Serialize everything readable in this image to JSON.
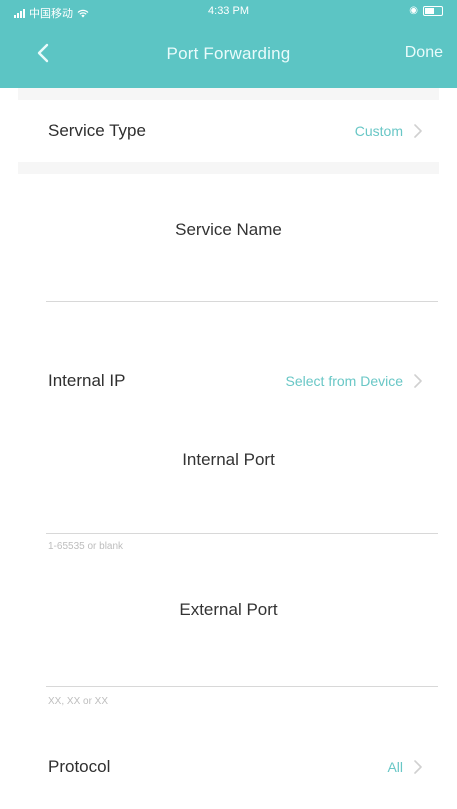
{
  "status_bar": {
    "carrier": "中国移动",
    "time": "4:33 PM",
    "battery_icon": "battery-icon",
    "wifi_icon": "wifi-icon"
  },
  "nav": {
    "title": "Port Forwarding",
    "done_label": "Done",
    "back_icon": "chevron-left-icon",
    "bg_color": "#5cc5c4",
    "text_color": "#e9fbfb"
  },
  "form": {
    "service_type": {
      "label": "Service Type",
      "value": "Custom"
    },
    "service_name": {
      "label": "Service Name",
      "value": "",
      "placeholder": ""
    },
    "internal_ip": {
      "label": "Internal IP",
      "value": "Select from Device"
    },
    "internal_port": {
      "label": "Internal Port",
      "value": "",
      "placeholder": "",
      "hint": "1-65535 or blank"
    },
    "external_port": {
      "label": "External Port",
      "value": "",
      "placeholder": "",
      "hint": "XX, XX or XX"
    },
    "protocol": {
      "label": "Protocol",
      "value": "All"
    }
  },
  "colors": {
    "accent": "#69c7c6",
    "label": "#2f2f2f",
    "separator": "#f6f6f6"
  }
}
